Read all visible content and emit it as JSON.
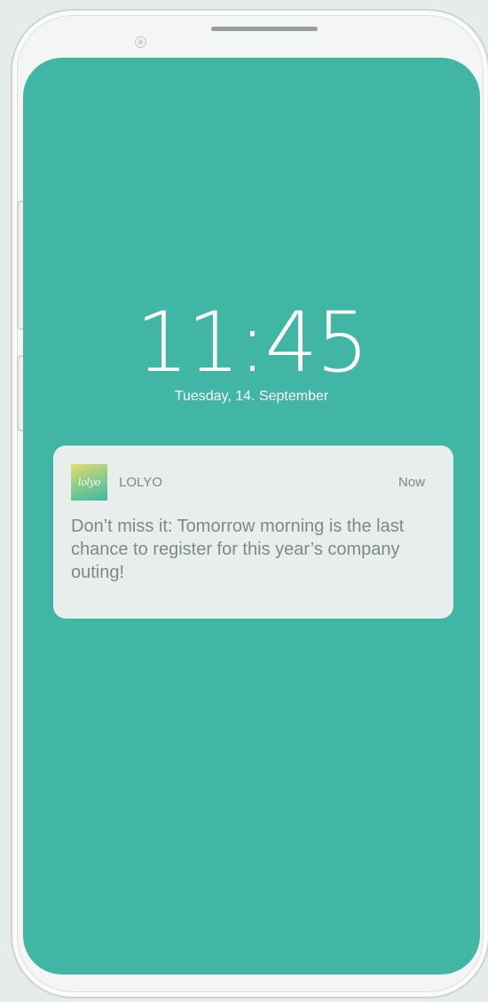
{
  "lock_screen": {
    "time": "11:45",
    "date": "Tuesday, 14. September"
  },
  "notification": {
    "app_icon_text": "lolyo",
    "app_name": "LOLYO",
    "timestamp": "Now",
    "message": "Don’t miss it: Tomorrow morning is the last chance to register for this year’s company outing!"
  },
  "colors": {
    "screen_background": "#42b6a5",
    "notification_background": "#e8eeec",
    "notification_text": "#7c8a88"
  }
}
